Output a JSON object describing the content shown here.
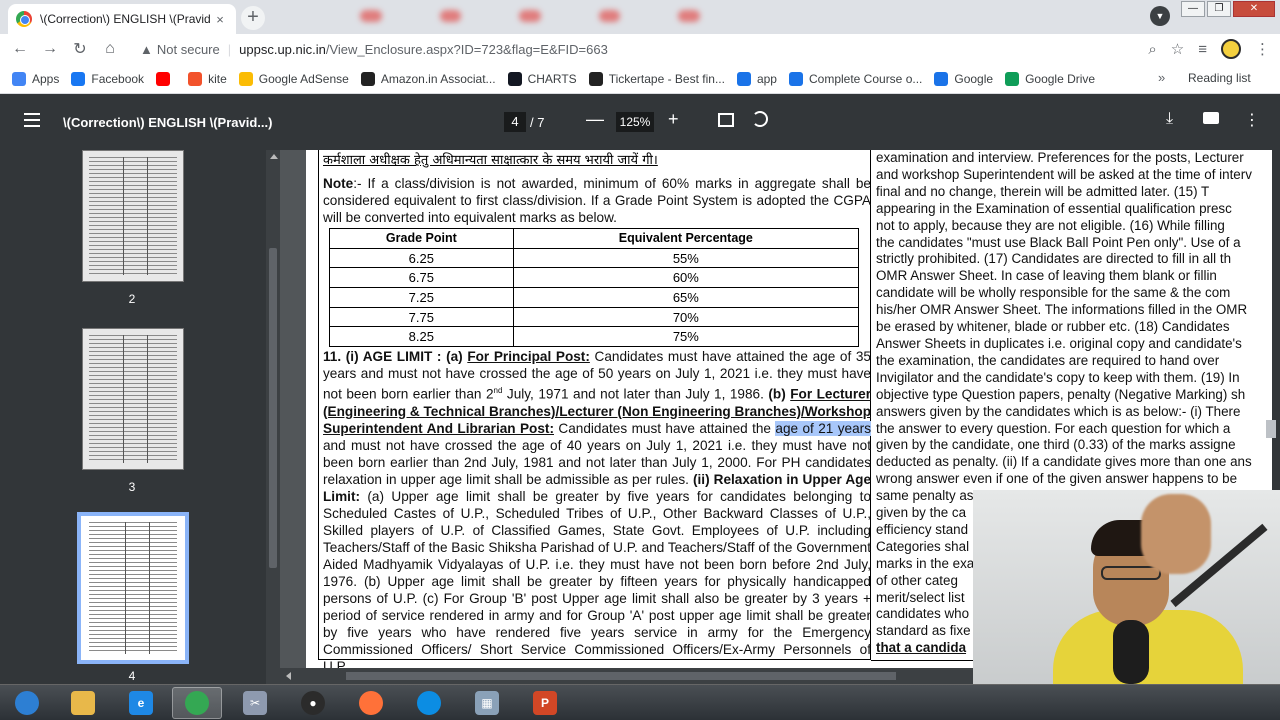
{
  "tab": {
    "title": "\\(Correction\\) ENGLISH \\(Pravid",
    "close": "×",
    "new_tab": "+"
  },
  "window_controls": {
    "minimize": "—",
    "maximize": "❐",
    "close": "✕"
  },
  "address": {
    "security_label": "Not secure",
    "host": "uppsc.up.nic.in",
    "path": "/View_Enclosure.aspx?ID=723&flag=E&FID=663"
  },
  "bookmarks": [
    {
      "label": "Apps",
      "icon": "apps-grid-icon",
      "color": "#4285f4"
    },
    {
      "label": "Facebook",
      "icon": "facebook-icon",
      "color": "#1877f2"
    },
    {
      "label": "",
      "icon": "youtube-icon",
      "color": "#ff0000"
    },
    {
      "label": "kite",
      "icon": "kite-icon",
      "color": "#f2522b"
    },
    {
      "label": "Google AdSense",
      "icon": "adsense-icon",
      "color": "#fbbc04"
    },
    {
      "label": "Amazon.in Associat...",
      "icon": "amazon-icon",
      "color": "#222222"
    },
    {
      "label": "CHARTS",
      "icon": "tradingview-icon",
      "color": "#131722"
    },
    {
      "label": "Tickertape - Best fin...",
      "icon": "tickertape-icon",
      "color": "#222222"
    },
    {
      "label": "app",
      "icon": "chevron-icon",
      "color": "#1a73e8"
    },
    {
      "label": "Complete Course o...",
      "icon": "course-icon",
      "color": "#1a73e8"
    },
    {
      "label": "Google",
      "icon": "google-icon",
      "color": "#1a73e8"
    },
    {
      "label": "Google Drive",
      "icon": "drive-icon",
      "color": "#0f9d58"
    }
  ],
  "bookmarks_more": "»",
  "reading_list": "Reading list",
  "pdf": {
    "title": "\\(Correction\\) ENGLISH \\(Pravid...)",
    "page_current": "4",
    "page_total": "/  7",
    "zoom": "125%",
    "zoom_minus": "—",
    "zoom_plus": "+",
    "download": "⤓",
    "more": "⋮"
  },
  "thumbnails": [
    {
      "label": "2"
    },
    {
      "label": "3"
    },
    {
      "label": "4"
    }
  ],
  "document": {
    "hindi_line": "कर्मशाला अधीक्षक हेतु अधिमान्यता साक्षात्कार के समय भरायी जायें गी।",
    "note_label": "Note",
    "note_text": ":- If a class/division is not awarded, minimum of 60% marks in aggregate shall be considered equivalent to first class/division. If a Grade Point System is adopted the CGPA will be converted into equivalent marks as below.",
    "grade_table": {
      "headers": [
        "Grade Point",
        "Equivalent Percentage"
      ],
      "rows": [
        [
          "6.25",
          "55%"
        ],
        [
          "6.75",
          "60%"
        ],
        [
          "7.25",
          "65%"
        ],
        [
          "7.75",
          "70%"
        ],
        [
          "8.25",
          "75%"
        ]
      ]
    },
    "sec11_a": "11. (i) AGE LIMIT : (a) ",
    "sec11_principal": "For Principal Post:",
    "sec11_p1": " Candidates must have attained the age of 35 years and must not have crossed the age of 50 years on July 1, 2021 i.e. they must have not been born earlier than 2",
    "sec11_nd": "nd",
    "sec11_p2": " July, 1971 and not later than July 1, 1986. ",
    "sec11_b": "(b) ",
    "sec11_lecturer": "For Lecturer (Engineering & Technical Branches)/Lecturer (Non Engineering Branches)/Workshop Superintendent And Librarian Post:",
    "sec11_p3": " Candidates must have attained the ",
    "sec11_highlight": "age of 21 years",
    "sec11_p4": " and must not have crossed the age of 40 years on July 1, 2021 i.e. they must have not been born earlier than 2nd July, 1981 and not later than July 1, 2000. For PH candidates relaxation in upper age limit shall be admissible as per rules. ",
    "sec11_relax": "(ii) Relaxation in Upper Age Limit:",
    "sec11_p5": " (a) Upper age limit shall be greater by five years for candidates belonging to Scheduled Castes of U.P., Scheduled Tribes of U.P., Other Backward Classes of U.P., Skilled players of U.P. of Classified Games, State Govt. Employees of U.P. including Teachers/Staff of the Basic Shiksha Parishad of U.P. and Teachers/Staff of the Government Aided Madhyamik Vidyalayas of U.P. i.e. they must have not been born before 2nd July, 1976. (b) Upper age limit shall be greater by fifteen years for physically handicapped persons of U.P. (c) For Group 'B' post Upper age limit shall also be greater by 3 years + period of service rendered in army and for Group 'A' post upper age limit shall be greater by five years who have rendered five years service in army for the Emergency Commissioned Officers/ Short Service Commissioned Officers/Ex-Army Personnels of U.P..",
    "right_lines": [
      "examination and interview.  Preferences for the posts, Lecturer",
      "and workshop Superintendent will be asked at the time of interv",
      "final and no change, therein will be admitted later. (15) T",
      "appearing in the Examination of essential qualification presc",
      "not to apply, because they are not eligible. (16) While filling",
      "the candidates \"must use Black Ball Point Pen only\". Use of a",
      "strictly prohibited. (17) Candidates are directed to fill in all th",
      "OMR Answer Sheet. In case of leaving them blank or fillin",
      "candidate will be wholly responsible for the same & the com",
      "his/her OMR Answer Sheet. The informations filled in the OMR",
      "be erased by whitener, blade or rubber etc. (18) Candidates",
      "Answer Sheets in duplicates i.e. original copy and candidate's",
      "the examination, the candidates are required to hand over",
      "Invigilator and the candidate's copy to keep with them. (19) In",
      "objective type Question papers, penalty (Negative Marking) sh",
      "answers given by the candidates which is as below:- (i) There",
      "the answer to every question. For each question for which a",
      "given by the candidate, one third (0.33) of the marks assigne",
      "deducted as penalty. (ii) If a candidate gives more than one ans",
      "wrong answer even if one of the given answer happens to be",
      "same penalty as above for that question. (iii) If a question is le",
      "given by the ca",
      "efficiency stand",
      "Categories shal",
      "marks in the exa",
      "of other categ",
      "merit/select list",
      "candidates who",
      "standard as fixe",
      "that a candida"
    ]
  },
  "taskbar": [
    {
      "name": "start-button",
      "icon": "windows-orb-icon",
      "color": "#2d7fd3",
      "label": ""
    },
    {
      "name": "taskbar-explorer",
      "icon": "folder-icon",
      "color": "#e8b84a",
      "label": ""
    },
    {
      "name": "taskbar-ie",
      "icon": "ie-icon",
      "color": "#1e88e5",
      "label": "e"
    },
    {
      "name": "taskbar-chrome",
      "icon": "chrome-icon",
      "color": "#34a853",
      "label": ""
    },
    {
      "name": "taskbar-snip",
      "icon": "scissors-icon",
      "color": "#8e9aaf",
      "label": "✂"
    },
    {
      "name": "taskbar-obs",
      "icon": "obs-icon",
      "color": "#2b2b2b",
      "label": "●"
    },
    {
      "name": "taskbar-firefox",
      "icon": "firefox-icon",
      "color": "#ff7139",
      "label": ""
    },
    {
      "name": "taskbar-edge",
      "icon": "edge-icon",
      "color": "#0c8de3",
      "label": ""
    },
    {
      "name": "taskbar-calculator",
      "icon": "calculator-icon",
      "color": "#8aa1b8",
      "label": "▦"
    },
    {
      "name": "taskbar-powerpoint",
      "icon": "powerpoint-icon",
      "color": "#d24726",
      "label": "P"
    }
  ]
}
